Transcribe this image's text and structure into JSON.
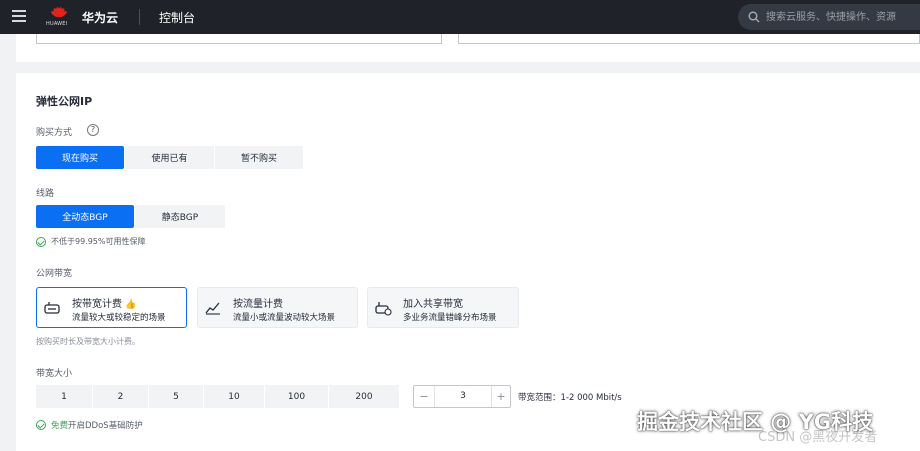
{
  "topbar": {
    "logo_text": "HUAWEI",
    "brand": "华为云",
    "console": "控制台",
    "search_placeholder": "搜索云服务、快捷操作、资源"
  },
  "eip": {
    "section_title": "弹性公网IP",
    "purchase_label": "购买方式",
    "purchase_options": [
      "现在购买",
      "使用已有",
      "暂不购买"
    ],
    "line_label": "线路",
    "line_options": [
      "全动态BGP",
      "静态BGP"
    ],
    "guarantee": "不低于99.95%可用性保障",
    "bandwidth_label": "公网带宽",
    "billing_cards": [
      {
        "title": "按带宽计费",
        "sub": "流量较大或较稳定的场景",
        "badge": "👍"
      },
      {
        "title": "按流量计费",
        "sub": "流量小或流量波动较大场景"
      },
      {
        "title": "加入共享带宽",
        "sub": "多业务流量错峰分布场景"
      }
    ],
    "billing_note": "按购买时长及带宽大小计费。",
    "size_label": "带宽大小",
    "size_options": [
      "1",
      "2",
      "5",
      "10",
      "100",
      "200"
    ],
    "stepper_value": "3",
    "stepper_minus": "−",
    "stepper_plus": "+",
    "range_text": "带宽范围：1-2 000 Mbit/s",
    "ddos_free": "免费",
    "ddos_text": "开启DDoS基础防护"
  },
  "watermark": {
    "main": "掘金技术社区 @ YG科技",
    "sub": "CSDN @黑夜开发者"
  },
  "colors": {
    "topbar_bg": "#1f2329",
    "accent": "#0a6ff3",
    "success": "#3ca454"
  }
}
